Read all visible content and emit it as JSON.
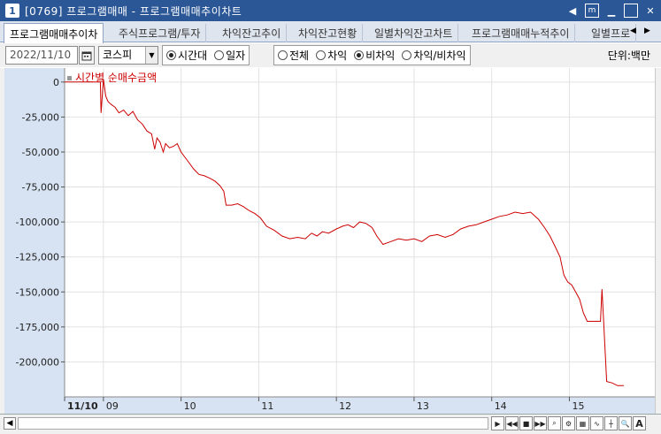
{
  "window": {
    "number": "1",
    "title": "[0769]  프로그램매매 - 프로그램매매추이차트"
  },
  "tabs": [
    {
      "label": "프로그램매매추이차",
      "active": true
    },
    {
      "label": "주식프로그램/투자",
      "active": false
    },
    {
      "label": "차익잔고추이",
      "active": false
    },
    {
      "label": "차익잔고현황",
      "active": false
    },
    {
      "label": "일별차익잔고차트",
      "active": false
    },
    {
      "label": "프로그램매매누적추이",
      "active": false
    },
    {
      "label": "일별프로",
      "active": false
    }
  ],
  "toolbar": {
    "date_value": "2022/11/10",
    "market_value": "코스피",
    "period_options": [
      {
        "label": "시간대",
        "selected": true
      },
      {
        "label": "일자",
        "selected": false
      }
    ],
    "type_options": [
      {
        "label": "전체",
        "selected": false
      },
      {
        "label": "차익",
        "selected": false
      },
      {
        "label": "비차익",
        "selected": true
      },
      {
        "label": "차익/비차익",
        "selected": false
      }
    ],
    "unit_label": "단위:백만"
  },
  "chart_data": {
    "type": "line",
    "title": "",
    "legend": {
      "label": "시간별 순매수금액",
      "position": "top-left",
      "color": "#cc0000"
    },
    "ylim": [
      -225000,
      10000
    ],
    "yticks": [
      0,
      -25000,
      -50000,
      -75000,
      -100000,
      -125000,
      -150000,
      -175000,
      -200000
    ],
    "ytick_labels": [
      "0",
      "-25,000",
      "-50,000",
      "-75,000",
      "-100,000",
      "-125,000",
      "-150,000",
      "-175,000",
      "-200,000"
    ],
    "x_range": [
      0,
      76
    ],
    "x_ticks": [
      {
        "label": "11/10",
        "x": 0,
        "bold": true
      },
      {
        "label": "09",
        "x": 5
      },
      {
        "label": "10",
        "x": 15
      },
      {
        "label": "11",
        "x": 25
      },
      {
        "label": "12",
        "x": 35
      },
      {
        "label": "13",
        "x": 45
      },
      {
        "label": "14",
        "x": 55
      },
      {
        "label": "15",
        "x": 65
      }
    ],
    "grid": true,
    "series": [
      {
        "name": "시간별 순매수금액",
        "color": "#cc0000",
        "points": [
          [
            0,
            0
          ],
          [
            4.6,
            0
          ],
          [
            4.7,
            -22000
          ],
          [
            5.0,
            2000
          ],
          [
            5.3,
            -10000
          ],
          [
            5.6,
            -14000
          ],
          [
            6.0,
            -16000
          ],
          [
            6.5,
            -18000
          ],
          [
            7.0,
            -22000
          ],
          [
            7.6,
            -20000
          ],
          [
            8.2,
            -24000
          ],
          [
            8.8,
            -21000
          ],
          [
            9.4,
            -27000
          ],
          [
            10.0,
            -30000
          ],
          [
            10.6,
            -35000
          ],
          [
            11.2,
            -37000
          ],
          [
            11.6,
            -48000
          ],
          [
            11.9,
            -40000
          ],
          [
            12.3,
            -43000
          ],
          [
            12.7,
            -50000
          ],
          [
            13.0,
            -44000
          ],
          [
            13.5,
            -47000
          ],
          [
            14.0,
            -46000
          ],
          [
            14.5,
            -44000
          ],
          [
            15.0,
            -50000
          ],
          [
            15.8,
            -56000
          ],
          [
            16.6,
            -62000
          ],
          [
            17.3,
            -66000
          ],
          [
            18.0,
            -67000
          ],
          [
            18.8,
            -69000
          ],
          [
            19.4,
            -71000
          ],
          [
            20.0,
            -74000
          ],
          [
            20.5,
            -78000
          ],
          [
            20.8,
            -88000
          ],
          [
            21.5,
            -88000
          ],
          [
            22.3,
            -87000
          ],
          [
            23.0,
            -89000
          ],
          [
            23.8,
            -92000
          ],
          [
            24.5,
            -94000
          ],
          [
            25.2,
            -97000
          ],
          [
            26.0,
            -103000
          ],
          [
            27.0,
            -106000
          ],
          [
            28.0,
            -110000
          ],
          [
            29.0,
            -112000
          ],
          [
            30.0,
            -111000
          ],
          [
            31.0,
            -112000
          ],
          [
            31.8,
            -108000
          ],
          [
            32.5,
            -110000
          ],
          [
            33.2,
            -107000
          ],
          [
            34.0,
            -108000
          ],
          [
            35.0,
            -105000
          ],
          [
            35.8,
            -103000
          ],
          [
            36.5,
            -102000
          ],
          [
            37.2,
            -104000
          ],
          [
            38.0,
            -100000
          ],
          [
            38.8,
            -101000
          ],
          [
            39.6,
            -104000
          ],
          [
            40.2,
            -110000
          ],
          [
            41.0,
            -116000
          ],
          [
            42.0,
            -114000
          ],
          [
            43.0,
            -112000
          ],
          [
            44.0,
            -113000
          ],
          [
            45.0,
            -112000
          ],
          [
            46.0,
            -114000
          ],
          [
            47.0,
            -110000
          ],
          [
            48.0,
            -109000
          ],
          [
            49.0,
            -111000
          ],
          [
            50.0,
            -109000
          ],
          [
            51.0,
            -105000
          ],
          [
            52.0,
            -103000
          ],
          [
            53.0,
            -102000
          ],
          [
            54.0,
            -100000
          ],
          [
            55.0,
            -98000
          ],
          [
            56.0,
            -96000
          ],
          [
            57.0,
            -95000
          ],
          [
            58.0,
            -93000
          ],
          [
            59.0,
            -94000
          ],
          [
            60.0,
            -93000
          ],
          [
            61.0,
            -98000
          ],
          [
            61.8,
            -104000
          ],
          [
            62.5,
            -110000
          ],
          [
            63.2,
            -118000
          ],
          [
            63.8,
            -125000
          ],
          [
            64.3,
            -138000
          ],
          [
            64.8,
            -143000
          ],
          [
            65.3,
            -145000
          ],
          [
            65.8,
            -150000
          ],
          [
            66.3,
            -155000
          ],
          [
            66.8,
            -165000
          ],
          [
            67.3,
            -171000
          ],
          [
            69.0,
            -171000
          ],
          [
            69.2,
            -148000
          ],
          [
            69.4,
            -170000
          ],
          [
            69.8,
            -214000
          ],
          [
            70.5,
            -215000
          ],
          [
            71.2,
            -217000
          ],
          [
            72.0,
            -217000
          ]
        ]
      }
    ]
  }
}
